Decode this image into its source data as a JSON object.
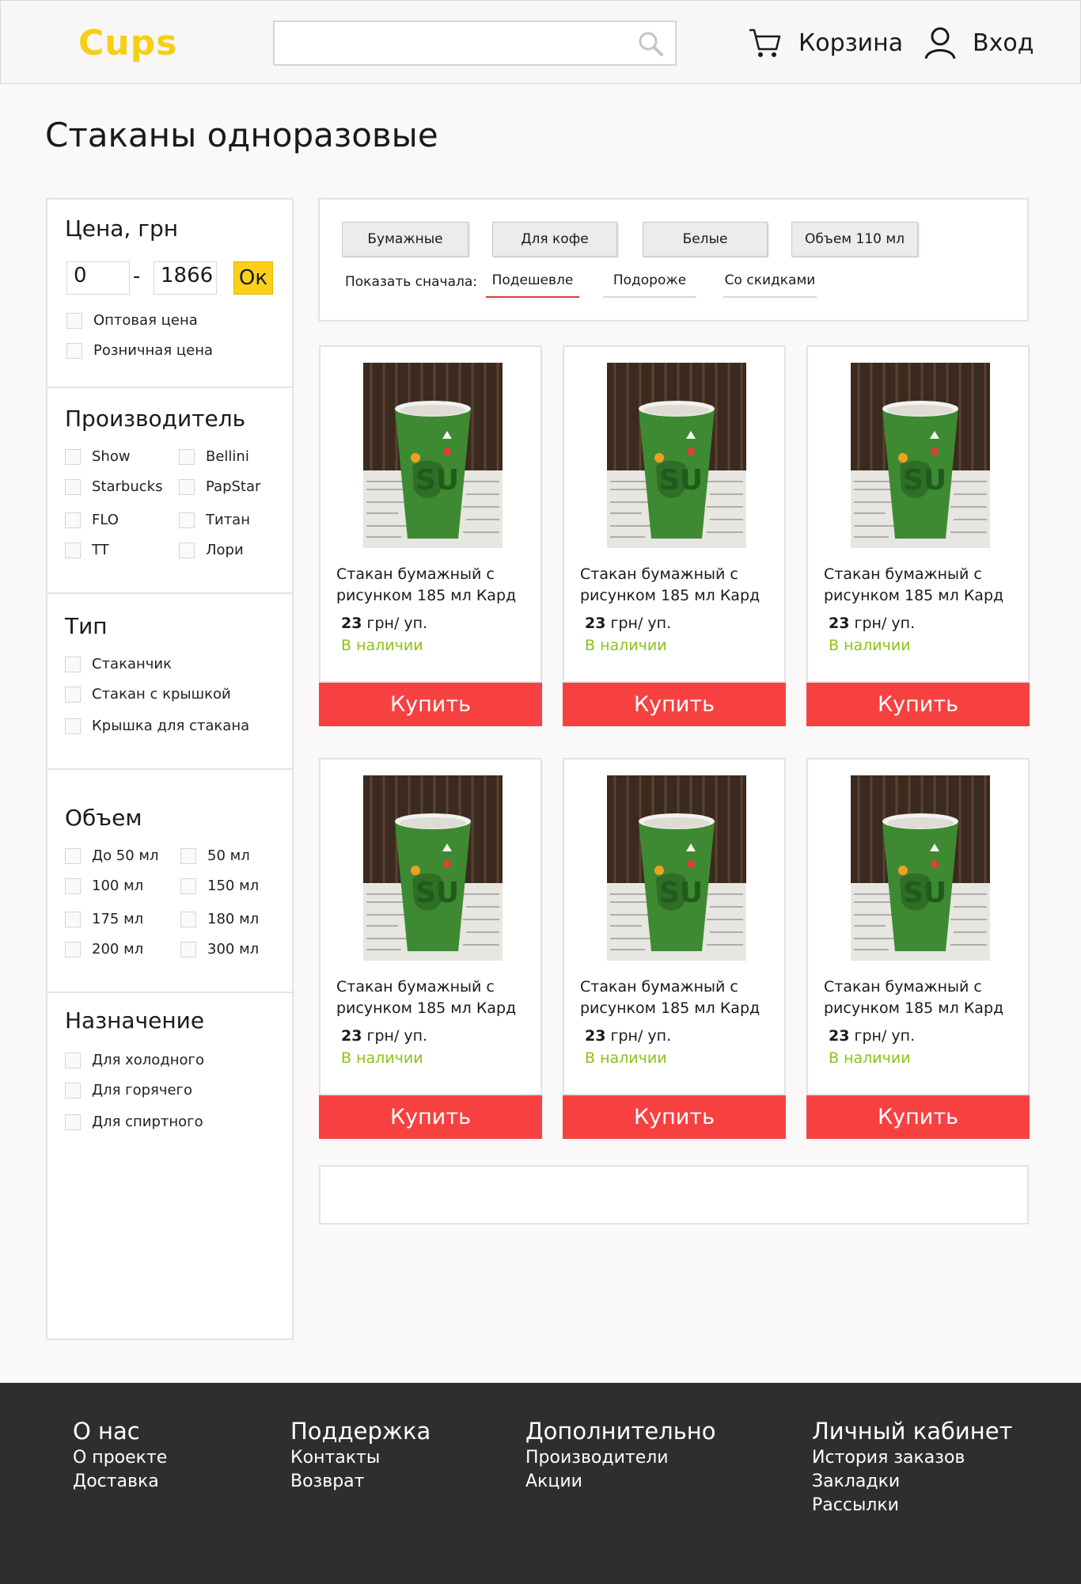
{
  "header": {
    "logo": "Cups",
    "search_placeholder": "",
    "cart_label": "Корзина",
    "login_label": "Вход"
  },
  "page_title": "Стаканы одноразовые",
  "filters": {
    "price": {
      "title": "Цена, грн",
      "min": "0",
      "dash": "-",
      "max": "1866",
      "ok": "Ок",
      "options": [
        "Оптовая цена",
        "Розничная цена"
      ]
    },
    "manufacturer": {
      "title": "Производитель",
      "options": [
        "Show",
        "Bellini",
        "Starbucks",
        "PapStar",
        "FLO",
        "Титан",
        "TT",
        "Лори"
      ]
    },
    "type": {
      "title": "Тип",
      "options": [
        "Стаканчик",
        "Стакан с крышкой",
        "Крышка для стакана"
      ]
    },
    "volume": {
      "title": "Объем",
      "options": [
        "До 50 мл",
        "50 мл",
        "100 мл",
        "150 мл",
        "175 мл",
        "180 мл",
        "200 мл",
        "300 мл"
      ]
    },
    "purpose": {
      "title": "Назначение",
      "options": [
        "Для холодного",
        "Для горячего",
        "Для спиртного"
      ]
    }
  },
  "chips": [
    "Бумажные",
    "Для кофе",
    "Белые",
    "Объем 110 мл"
  ],
  "sort": {
    "label": "Показать сначала:",
    "options": [
      "Подешевле",
      "Подороже",
      "Со скидками"
    ],
    "active_index": 0
  },
  "products": [
    {
      "name": "Стакан бумажный с рисунком 185 мл Кард",
      "price": "23",
      "unit": " грн/ уп.",
      "stock": "В наличии",
      "buy": "Купить"
    },
    {
      "name": "Стакан бумажный с рисунком 185 мл Кард",
      "price": "23",
      "unit": " грн/ уп.",
      "stock": "В наличии",
      "buy": "Купить"
    },
    {
      "name": "Стакан бумажный с рисунком 185 мл Кард",
      "price": "23",
      "unit": " грн/ уп.",
      "stock": "В наличии",
      "buy": "Купить"
    },
    {
      "name": "Стакан бумажный с рисунком 185 мл Кард",
      "price": "23",
      "unit": " грн/ уп.",
      "stock": "В наличии",
      "buy": "Купить"
    },
    {
      "name": "Стакан бумажный с рисунком 185 мл Кард",
      "price": "23",
      "unit": " грн/ уп.",
      "stock": "В наличии",
      "buy": "Купить"
    },
    {
      "name": "Стакан бумажный с рисунком 185 мл Кард",
      "price": "23",
      "unit": " грн/ уп.",
      "stock": "В наличии",
      "buy": "Купить"
    }
  ],
  "footer": {
    "about": {
      "title": "О нас",
      "links": [
        "О проекте",
        "Доставка"
      ]
    },
    "support": {
      "title": "Поддержка",
      "links": [
        "Контакты",
        "Возврат"
      ]
    },
    "extra": {
      "title": "Дополнительно",
      "links": [
        "Производители",
        "Акции"
      ]
    },
    "account": {
      "title": "Личный кабинет",
      "links": [
        "История заказов",
        "Закладки",
        "Рассылки"
      ]
    }
  },
  "colors": {
    "accent_yellow": "#f7cf12",
    "buy_red": "#f74141",
    "in_stock_green": "#8cc21a",
    "footer_bg": "#2e2e2e"
  }
}
